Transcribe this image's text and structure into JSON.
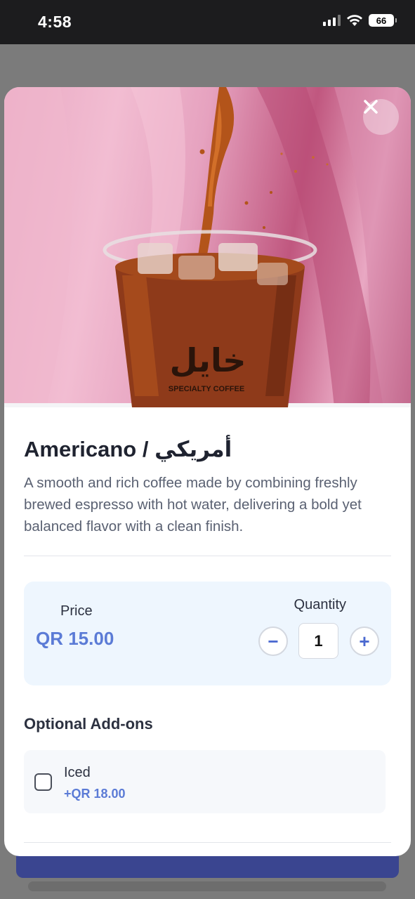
{
  "status_bar": {
    "time": "4:58",
    "battery": "66"
  },
  "product": {
    "title": "Americano / أمريكي",
    "description": "A smooth and rich coffee made by combining freshly brewed espresso with hot water, delivering a bold yet balanced flavor with a clean finish.",
    "image_brand_text": "خايل",
    "image_brand_sub": "SPECIALTY COFFEE"
  },
  "price_card": {
    "price_label": "Price",
    "price_value": "QR 15.00",
    "quantity_label": "Quantity",
    "quantity_value": "1",
    "minus_symbol": "−",
    "plus_symbol": "+"
  },
  "addons": {
    "title": "Optional Add-ons",
    "items": [
      {
        "name": "Iced",
        "price": "+QR 18.00",
        "checked": false
      }
    ]
  },
  "colors": {
    "accent": "#5b7bd6",
    "price_card_bg": "#eef6fe",
    "cart_button": "#3a4590"
  },
  "icons": {
    "close": "close-icon"
  }
}
